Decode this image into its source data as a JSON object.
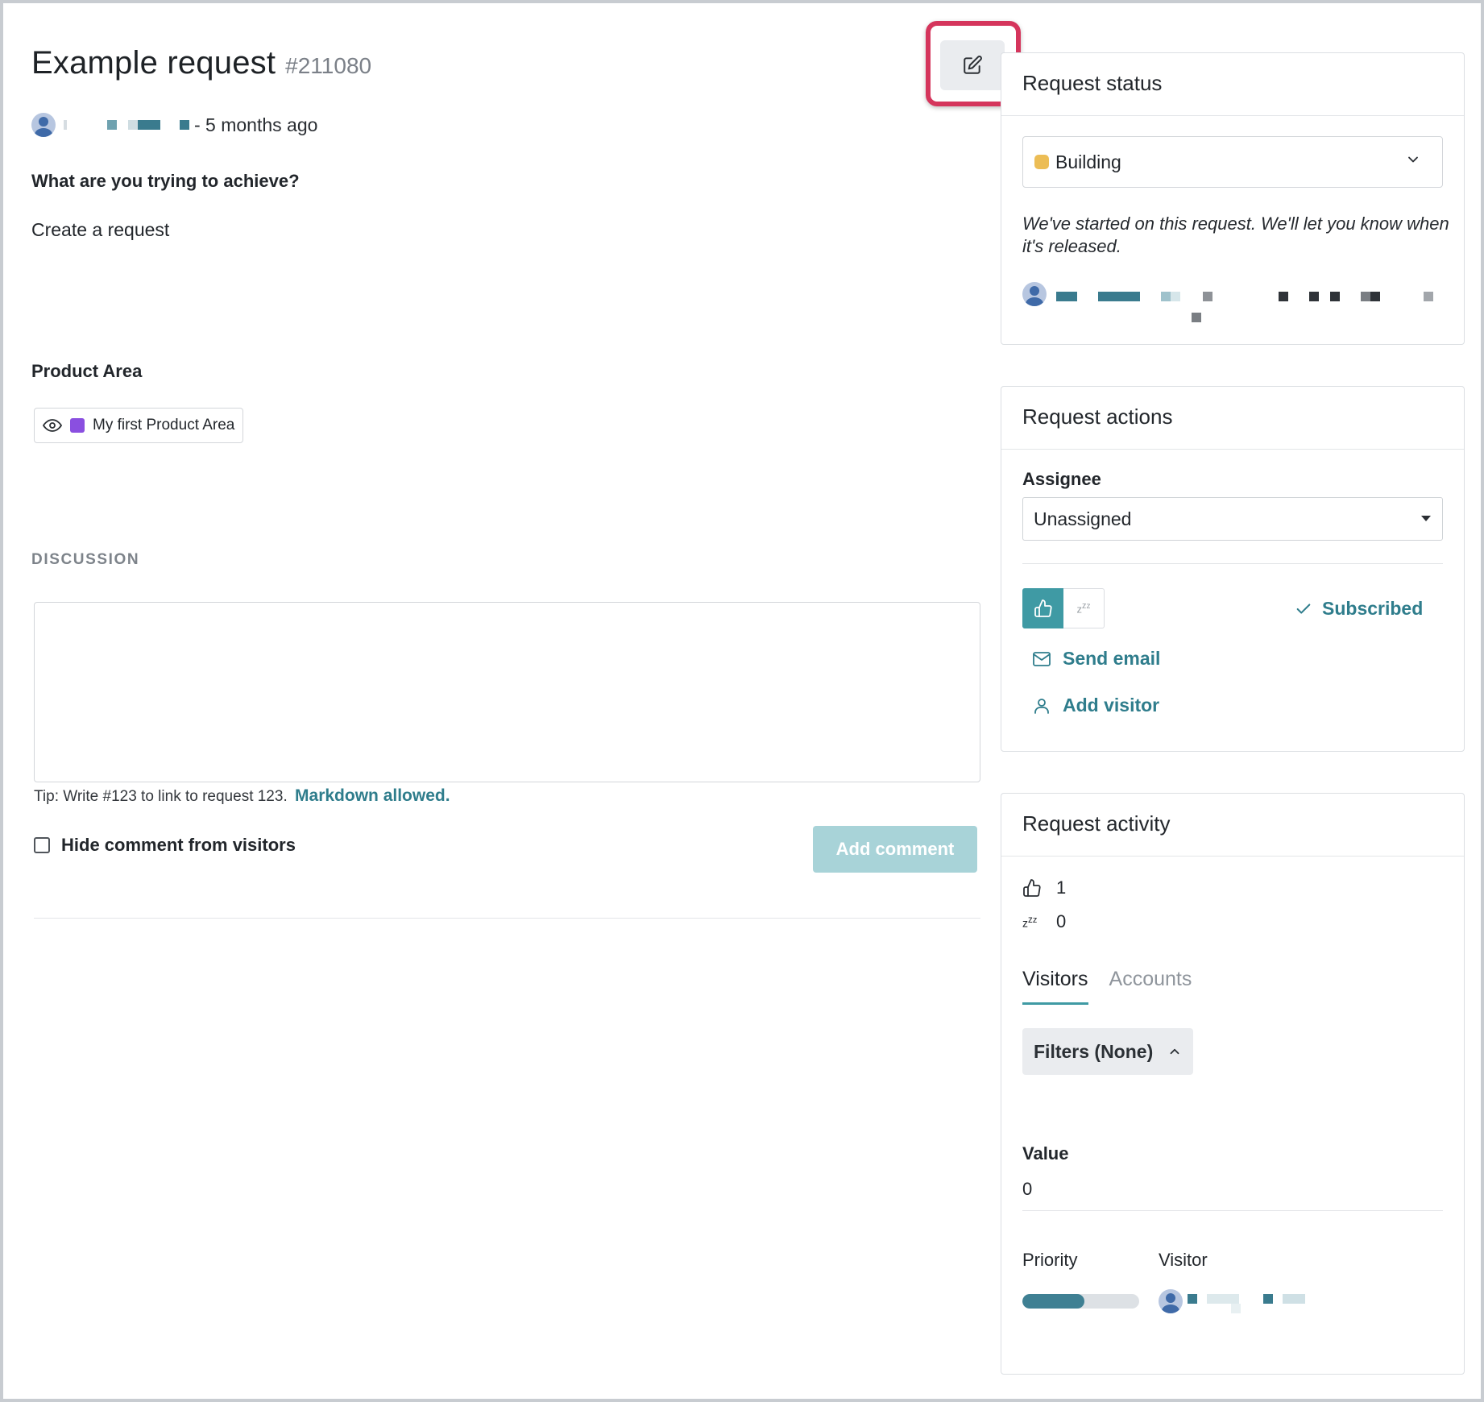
{
  "request": {
    "title": "Example request",
    "number": "#211080",
    "time_ago": "- 5 months ago",
    "question_label": "What are you trying to achieve?",
    "question_answer": "Create a request",
    "product_area_label": "Product Area",
    "product_area_value": "My first Product Area",
    "product_area_color": "#8a4fe0"
  },
  "discussion": {
    "label": "DISCUSSION",
    "tip_text": "Tip: Write #123 to link to request 123.",
    "markdown_link": "Markdown allowed.",
    "hide_label": "Hide comment from visitors",
    "add_comment_label": "Add comment"
  },
  "status_card": {
    "title": "Request status",
    "status_value": "Building",
    "status_color": "#ecbd55",
    "description": "We've started on this request. We'll let you know when it's released."
  },
  "actions_card": {
    "title": "Request actions",
    "assignee_label": "Assignee",
    "assignee_value": "Unassigned",
    "subscribed_label": "Subscribed",
    "send_email_label": "Send email",
    "add_visitor_label": "Add visitor",
    "accent_color": "#3f9aa4"
  },
  "activity_card": {
    "title": "Request activity",
    "upvotes": "1",
    "snoozes": "0",
    "tabs": [
      {
        "label": "Visitors",
        "active": true
      },
      {
        "label": "Accounts",
        "active": false
      }
    ],
    "filters_label": "Filters (None)",
    "value_label": "Value",
    "value_number": "0",
    "priority_label": "Priority",
    "visitor_label": "Visitor",
    "priority_fraction": 0.53
  },
  "icons": {
    "edit": "edit-icon",
    "eye": "eye-icon",
    "chevron": "chevron-down-icon",
    "thumbs_up": "thumbs-up-icon",
    "snooze": "snooze-icon",
    "check": "check-icon",
    "mail": "mail-icon",
    "user": "user-icon",
    "chevron_up": "chevron-up-icon"
  }
}
